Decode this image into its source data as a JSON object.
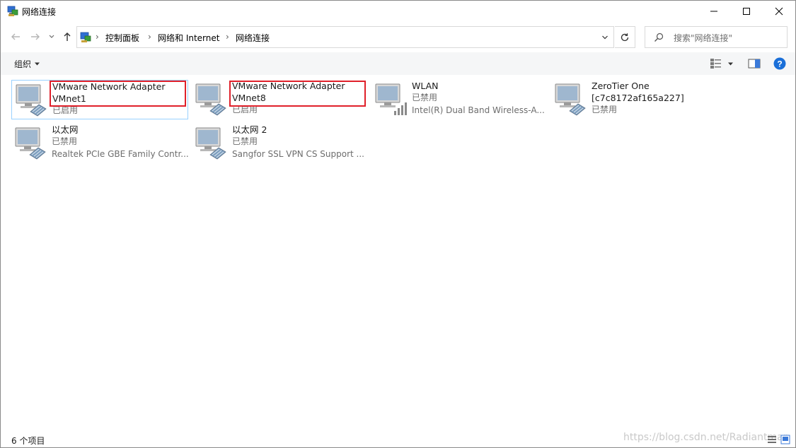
{
  "window": {
    "title": "网络连接",
    "minimize_icon": "minimize-icon",
    "maximize_icon": "maximize-icon",
    "close_icon": "close-icon"
  },
  "address_bar": {
    "breadcrumbs": [
      "控制面板",
      "网络和 Internet",
      "网络连接"
    ],
    "separator": "›",
    "search_placeholder": "搜索\"网络连接\""
  },
  "command_bar": {
    "organize_label": "组织",
    "organize_icon": "chevron-down-icon",
    "view_icon": "view-options-icon",
    "preview_icon": "preview-pane-icon",
    "help_icon": "help-icon"
  },
  "connections": [
    {
      "name": "VMware Network Adapter",
      "name2": "VMnet1",
      "status": "已启用",
      "device": "",
      "icon": "network-adapter-icon",
      "highlighted": true,
      "selected": true
    },
    {
      "name": "VMware Network Adapter",
      "name2": "VMnet8",
      "status": "已启用",
      "device": "",
      "icon": "network-adapter-icon",
      "highlighted": true,
      "selected": false
    },
    {
      "name": "WLAN",
      "name2": "",
      "status": "已禁用",
      "device": "Intel(R) Dual Band Wireless-A...",
      "icon": "wireless-adapter-icon",
      "highlighted": false,
      "selected": false
    },
    {
      "name": "ZeroTier One",
      "name2": "[c7c8172af165a227]",
      "status": "已禁用",
      "device": "",
      "icon": "network-adapter-icon",
      "highlighted": false,
      "selected": false
    },
    {
      "name": "以太网",
      "name2": "",
      "status": "已禁用",
      "device": "Realtek PCIe GBE Family Contr...",
      "icon": "network-adapter-icon",
      "highlighted": false,
      "selected": false
    },
    {
      "name": "以太网 2",
      "name2": "",
      "status": "已禁用",
      "device": "Sangfor SSL VPN CS Support ...",
      "icon": "network-adapter-icon",
      "highlighted": false,
      "selected": false
    }
  ],
  "status_bar": {
    "item_count": "6 个项目",
    "watermark": "https://blog.csdn.net/Radiantman"
  },
  "colors": {
    "highlight_box": "#e0202a",
    "selection_border": "#99d1ff",
    "help_blue": "#1a6fd8"
  }
}
